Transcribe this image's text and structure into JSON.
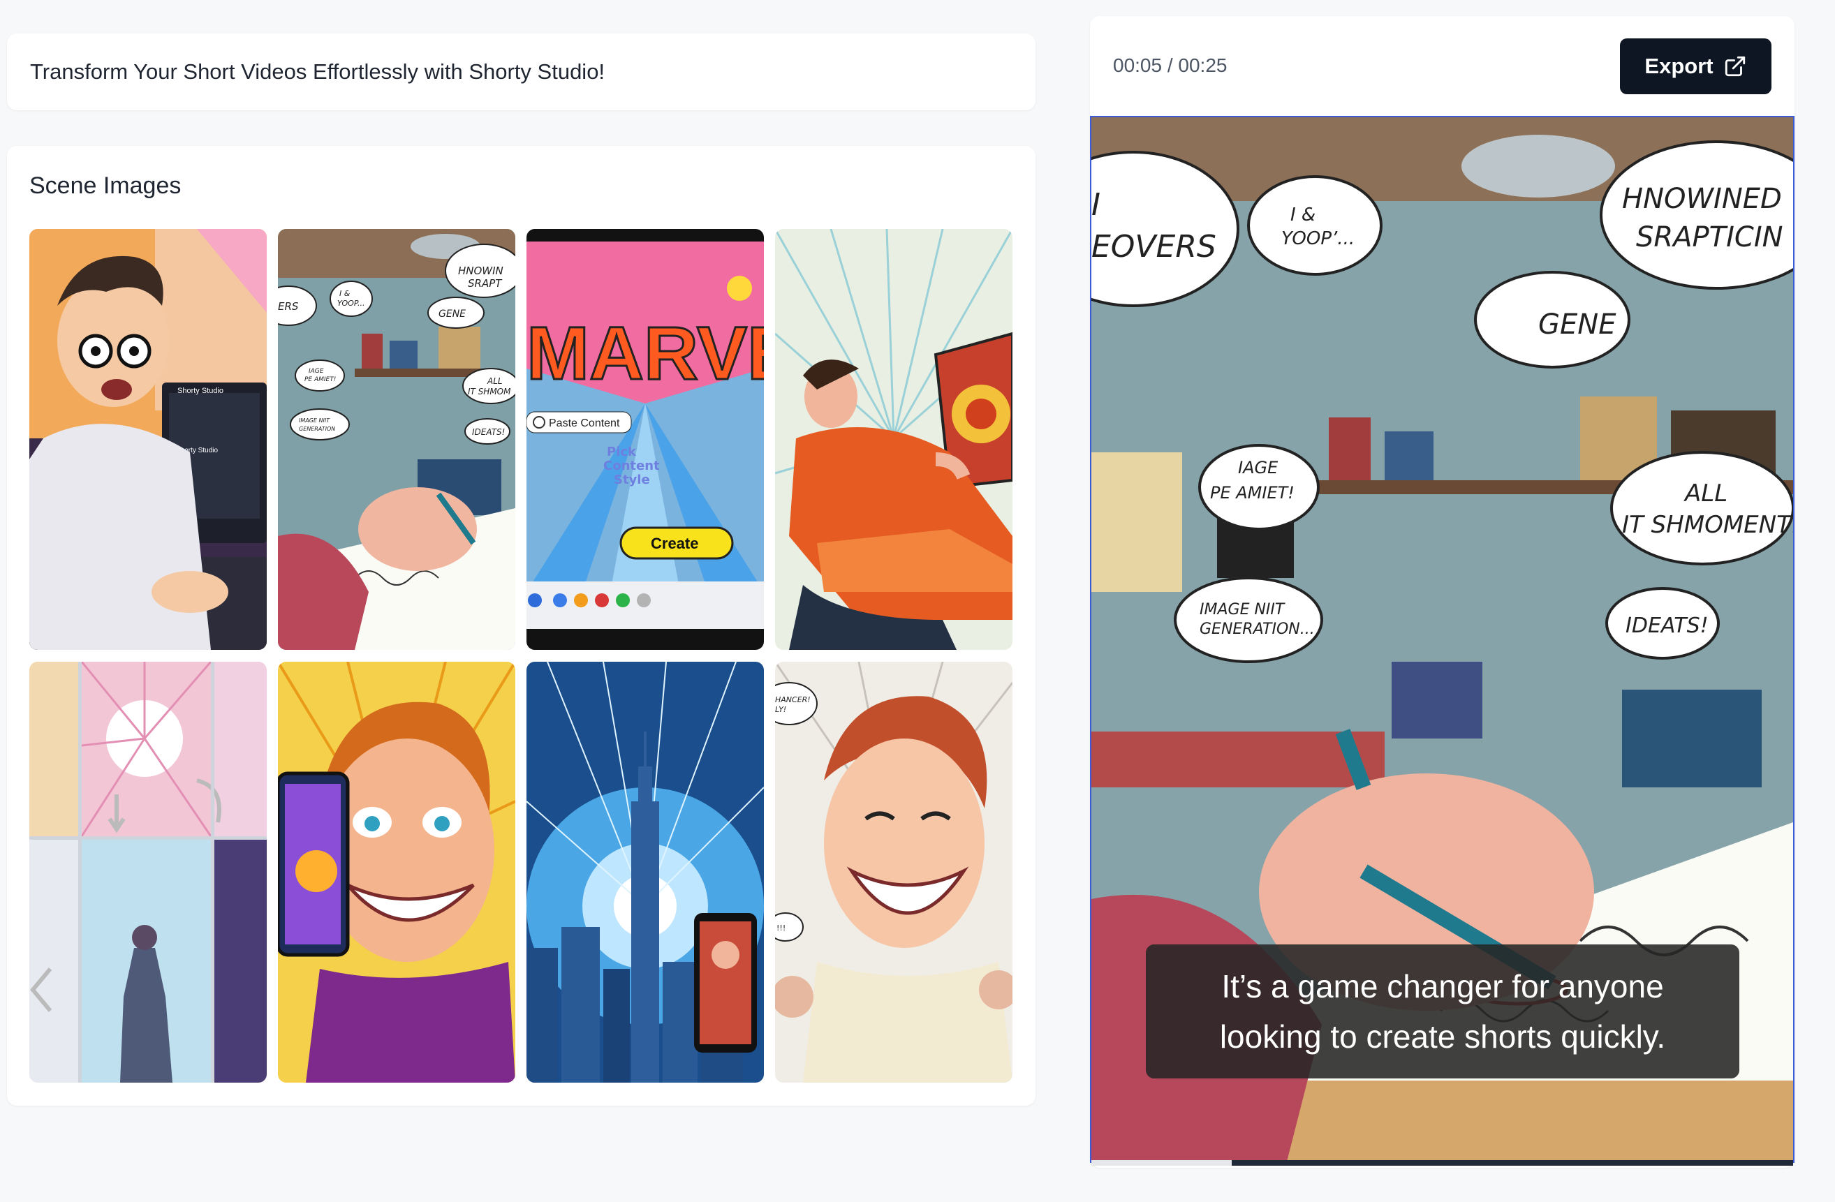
{
  "header": {
    "title": "Transform Your Short Videos Effortlessly with Shorty Studio!"
  },
  "scenes": {
    "title": "Scene Images",
    "thumb_texts": {
      "scene2": [
        "HNOWIN",
        "SRAPT",
        "ERS",
        "I &",
        "YOOP...",
        "GENE",
        "IAGE",
        "PE AMIET!",
        "ALL",
        "IT SHMOM",
        "IMAGE NIIT",
        "GENERATION",
        "IDEATS!"
      ],
      "scene3": [
        "MARVEL",
        "Paste Content",
        "Pick",
        "Content",
        "Style",
        "Create"
      ],
      "scene1": [
        "Shorty Studio",
        "Shorty Studio"
      ],
      "scene8": [
        "HANCER!",
        "LY!",
        "!!!"
      ]
    }
  },
  "player": {
    "time": "00:05 / 00:25",
    "export_label": "Export",
    "progress": 0.2,
    "caption": "It’s a game changer for anyone looking to create shorts quickly.",
    "bubbles": [
      "I",
      "EOVERS",
      "I &",
      "YOOP’...",
      "HNOWINED",
      "SRAPTICIN",
      "GENE",
      "IAGE",
      "PE AMIET!",
      "ALL",
      "IT SHMOMENT!",
      "IMAGE NIIT",
      "GENERATION...",
      "IDEATS!"
    ]
  },
  "colors": {
    "export_bg": "#0f1623",
    "video_border": "#3b5bd6",
    "caption_bg": "#262626"
  },
  "icons": {
    "export": "external-link-icon"
  }
}
